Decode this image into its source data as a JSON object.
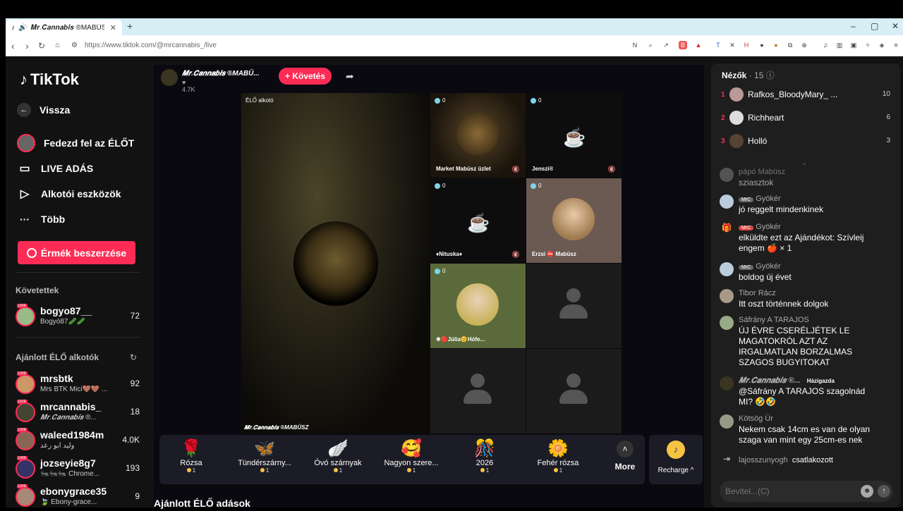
{
  "browser": {
    "tab_title": "𝑴𝒓.𝑪𝒂𝒏𝒏𝒂𝒃𝒊𝒔 ®MABÜSZ",
    "url": "https://www.tiktok.com/@mrcannabis_/live"
  },
  "sidebar": {
    "logo": "TikTok",
    "back": "Vissza",
    "nav": [
      {
        "label": "Fedezd fel az ÉLŐT",
        "icon": "avatar-icon"
      },
      {
        "label": "LIVE ADÁS",
        "icon": "video-camera-icon"
      },
      {
        "label": "Alkotói eszközök",
        "icon": "creator-tools-icon"
      },
      {
        "label": "Több",
        "icon": "more-dots-icon"
      }
    ],
    "coins_button": "Érmék beszerzése",
    "following_title": "Követettek",
    "following": [
      {
        "name": "bogyo87__",
        "sub": "Bogyó87🥒🥒",
        "count": "72"
      }
    ],
    "suggested_title": "Ajánlott ÉLŐ alkotók",
    "suggested": [
      {
        "name": "mrsbtk",
        "sub": "Mrs BTK Mici🤎🤎 ...",
        "count": "92"
      },
      {
        "name": "mrcannabis_",
        "sub": "𝑴𝒓.𝑪𝒂𝒏𝒏𝒂𝒃𝒊𝒔 ®...",
        "count": "18"
      },
      {
        "name": "waleed1984m",
        "sub": "وليد ابو رعد",
        "count": "4.0K"
      },
      {
        "name": "jozseyie8g7",
        "sub": "🐜🐜🐜 Chrome...",
        "count": "193"
      },
      {
        "name": "ebonygrace35",
        "sub": "🍃 Ebony-grace...",
        "count": "9"
      }
    ]
  },
  "stream": {
    "host_name": "𝑴𝒓.𝑪𝒂𝒏𝒏𝒂𝒃𝒊𝒔 ®MABÜ...",
    "likes": "4.7K",
    "follow_label": "+ Követés",
    "main_label": "ÉLŐ alkotó",
    "main_name": "𝑴𝒓.𝑪𝒂𝒏𝒏𝒂𝒃𝒊𝒔 ®MABÜSZ",
    "guests": [
      {
        "name": "Market Mabüsz üzlet",
        "count": "0"
      },
      {
        "name": "Jenszi®",
        "count": "0"
      },
      {
        "name": "♦Nituska♦",
        "count": "0"
      },
      {
        "name": "Erzsi ⛔ Mabüsz",
        "count": "0"
      },
      {
        "name": "❄🔴Júlia😊Hófe...",
        "count": "0"
      }
    ]
  },
  "gifts": [
    {
      "name": "Rózsa",
      "price": "1",
      "icon": "🌹"
    },
    {
      "name": "Tündérszárny...",
      "price": "1",
      "icon": "🦋"
    },
    {
      "name": "Óvó szárnyak",
      "price": "1",
      "icon": "🪽"
    },
    {
      "name": "Nagyon szere...",
      "price": "1",
      "icon": "🥰"
    },
    {
      "name": "2026",
      "price": "1",
      "icon": "🎊"
    },
    {
      "name": "Fehér rózsa",
      "price": "1",
      "icon": "🌼"
    }
  ],
  "gift_more": "More",
  "recharge": "Recharge ^",
  "recommended_title": "Ajánlott ÉLŐ adások",
  "viewers": {
    "title": "Nézők",
    "count": "· 15",
    "list": [
      {
        "rank": "1",
        "name": "Rafkos_BloodyMary_ ...",
        "score": "10"
      },
      {
        "rank": "2",
        "name": "Richheart",
        "score": "6"
      },
      {
        "rank": "3",
        "name": "Holló",
        "score": "3"
      }
    ]
  },
  "chat": [
    {
      "user": "pápó Mabüsz",
      "text": "sziasztok",
      "tag": ""
    },
    {
      "user": "Gyökér",
      "text": "jó reggelt mindenkinek",
      "tag": "MrC"
    },
    {
      "user": "Gyökér",
      "text": "elküldte ezt az Ajándékot: Szívleij engem 🍎 × 1",
      "tag": "MrC"
    },
    {
      "user": "Gyökér",
      "text": "boldog új évet",
      "tag": "MrC"
    },
    {
      "user": "Tibor Rácz",
      "text": "Itt oszt történnek dolgok",
      "tag": ""
    },
    {
      "user": "Sáfrány A TARAJOS",
      "text": "ÚJ ÉVRE CSERÉLJÉTEK LE MAGATOKRÓL AZT AZ IRGALMATLAN BORZALMAS SZAGOS BUGYITOKAT",
      "tag": ""
    },
    {
      "user": "𝑴𝒓.𝑪𝒂𝒏𝒏𝒂𝒃𝒊𝒔 ®...",
      "text": "@Sáfrány A TARAJOS szagolnád MI? 🤣🤣",
      "tag": "Házigazda"
    },
    {
      "user": "Kötsög Úr",
      "text": "Nekem csak 14cm es van de olyan szaga van mint egy 25cm-es nek",
      "tag": ""
    }
  ],
  "join_msg": {
    "user": "lajosszunyogh",
    "text": "csatlakozott"
  },
  "chat_input": {
    "placeholder": "Bevitel...(C)"
  }
}
